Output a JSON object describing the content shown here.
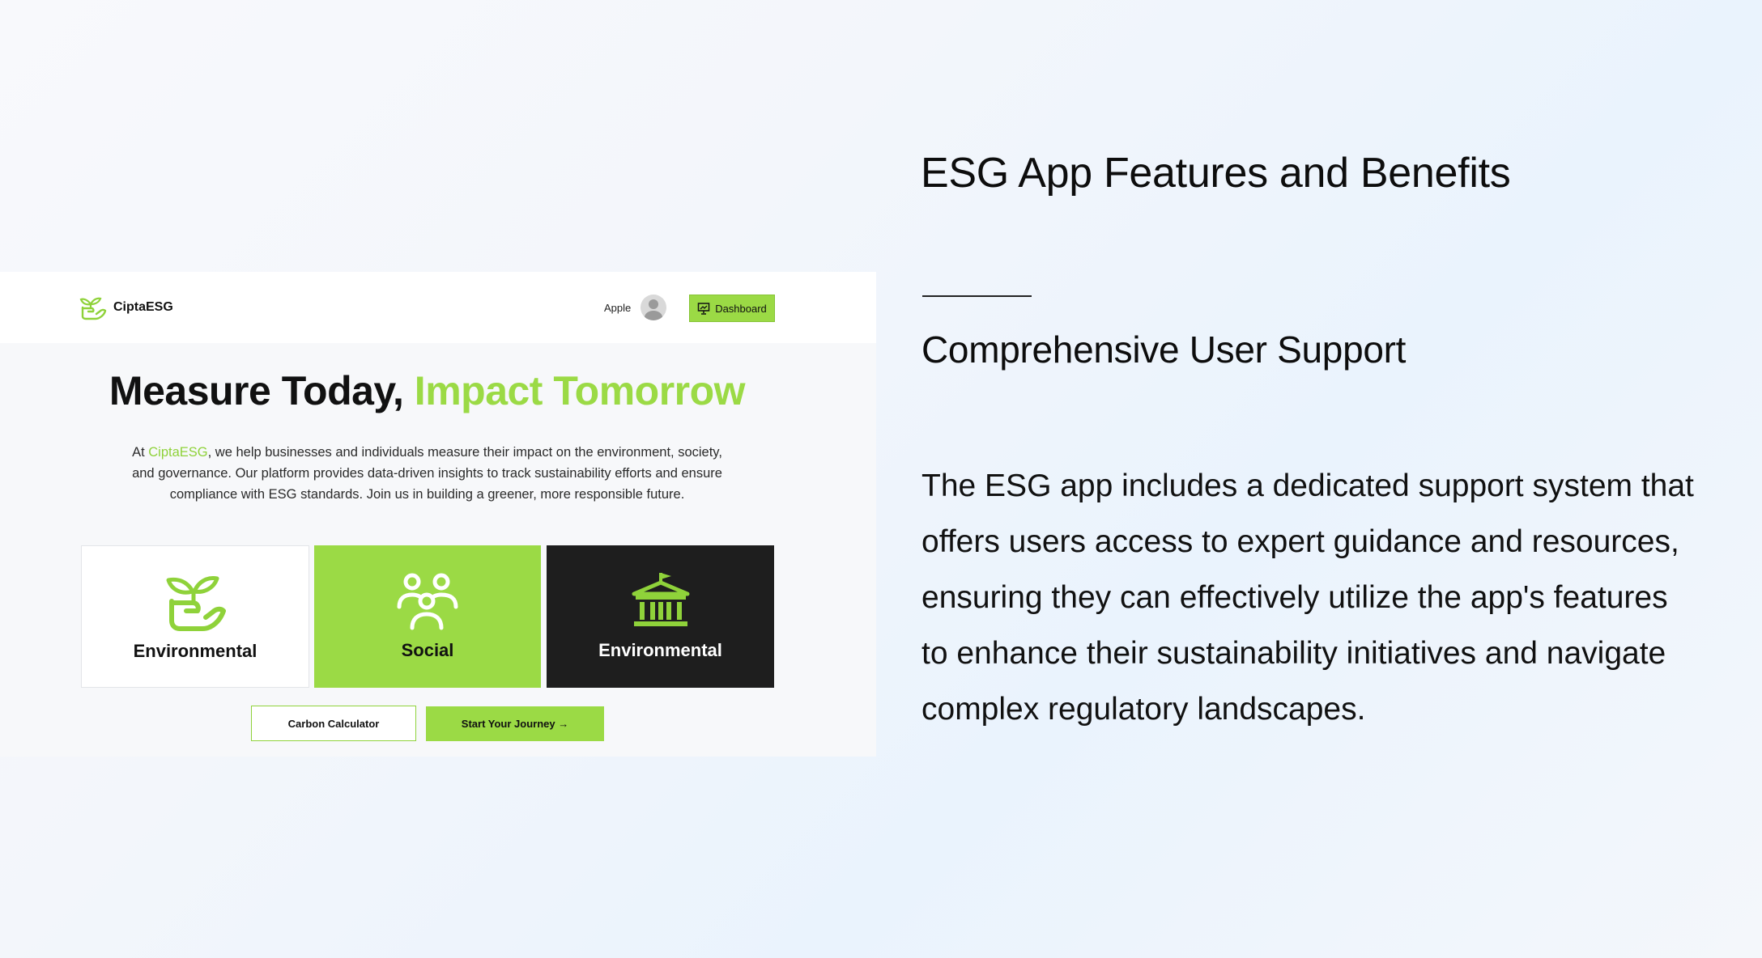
{
  "screenshot": {
    "brand": {
      "name": "CiptaESG"
    },
    "user": {
      "name": "Apple"
    },
    "dashboard_label": "Dashboard",
    "headline": {
      "part1": "Measure Today, ",
      "part2": "Impact Tomorrow"
    },
    "intro": {
      "prefix": "At ",
      "brand": "CiptaESG",
      "text": ", we help businesses and individuals measure their impact on the environment, society, and governance. Our platform provides data-driven insights to track sustainability efforts and ensure compliance with ESG standards. Join us in building a greener, more responsible future."
    },
    "cards": [
      {
        "label": "Environmental",
        "icon": "plant-in-hand-icon"
      },
      {
        "label": "Social",
        "icon": "people-group-icon"
      },
      {
        "label": "Environmental",
        "icon": "government-building-icon"
      }
    ],
    "buttons": {
      "carbon_calculator": "Carbon Calculator",
      "start_journey": "Start Your Journey →"
    },
    "colors": {
      "accent": "#9bda45",
      "dark_card": "#1e1e1e"
    }
  },
  "feature": {
    "title": "ESG App Features and Benefits",
    "subtitle": "Comprehensive User Support",
    "body": "The ESG app includes a dedicated support system that offers users access to expert guidance and resources, ensuring they can effectively utilize the app's features to enhance their sustainability initiatives and navigate complex regulatory landscapes."
  }
}
